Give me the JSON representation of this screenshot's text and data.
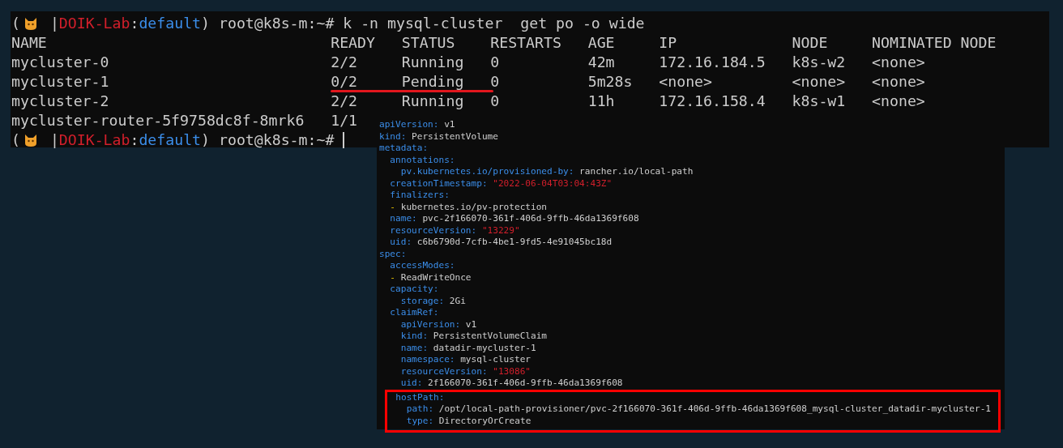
{
  "terminal": {
    "prompt": {
      "open": "(",
      "sep": " |",
      "context": "DOIK-Lab",
      "colon": ":",
      "namespace": "default",
      "rest": ") root@k8s-m:~#",
      "command": "k -n mysql-cluster  get po -o wide"
    },
    "columns": [
      "NAME",
      "READY",
      "STATUS",
      "RESTARTS",
      "AGE",
      "IP",
      "NODE",
      "NOMINATED NODE"
    ],
    "rows": [
      {
        "cells": [
          "mycluster-0",
          "2/2",
          "Running",
          "0",
          "42m",
          "172.16.184.5",
          "k8s-w2",
          "<none>"
        ],
        "underlined": false
      },
      {
        "cells": [
          "mycluster-1",
          "0/2",
          "Pending",
          "0",
          "5m28s",
          "<none>",
          "<none>",
          "<none>"
        ],
        "underlined": true
      },
      {
        "cells": [
          "mycluster-2",
          "2/2",
          "Running",
          "0",
          "11h",
          "172.16.158.4",
          "k8s-w1",
          "<none>"
        ],
        "underlined": false
      },
      {
        "cells": [
          "mycluster-router-5f9758dc8f-8mrk6",
          "1/1"
        ],
        "underlined": false
      }
    ],
    "prompt2": {
      "open": "(",
      "sep": " |",
      "context": "DOIK-Lab",
      "colon": ":",
      "namespace": "default",
      "rest": ") root@k8s-m:~#",
      "cursor": true
    }
  },
  "yaml": [
    {
      "key": "apiVersion:",
      "value": "v1",
      "kind": "plain"
    },
    {
      "key": "kind:",
      "value": "PersistentVolume",
      "kind": "plain"
    },
    {
      "key": "metadata:",
      "children": [
        {
          "key": "annotations:",
          "children": [
            {
              "key": "pv.kubernetes.io/provisioned-by:",
              "value": "rancher.io/local-path",
              "kind": "plain"
            }
          ]
        },
        {
          "key": "creationTimestamp:",
          "value": "\"2022-06-04T03:04:43Z\"",
          "kind": "string"
        },
        {
          "key": "finalizers:"
        },
        {
          "bullet": "-",
          "value": "kubernetes.io/pv-protection",
          "kind": "plain"
        },
        {
          "key": "name:",
          "value": "pvc-2f166070-361f-406d-9ffb-46da1369f608",
          "kind": "plain"
        },
        {
          "key": "resourceVersion:",
          "value": "\"13229\"",
          "kind": "string"
        },
        {
          "key": "uid:",
          "value": "c6b6790d-7cfb-4be1-9fd5-4e91045bc18d",
          "kind": "plain"
        }
      ]
    },
    {
      "key": "spec:",
      "children": [
        {
          "key": "accessModes:"
        },
        {
          "bullet": "-",
          "value": "ReadWriteOnce",
          "kind": "plain"
        },
        {
          "key": "capacity:",
          "children": [
            {
              "key": "storage:",
              "value": "2Gi",
              "kind": "plain"
            }
          ]
        },
        {
          "key": "claimRef:",
          "children": [
            {
              "key": "apiVersion:",
              "value": "v1",
              "kind": "plain"
            },
            {
              "key": "kind:",
              "value": "PersistentVolumeClaim",
              "kind": "plain"
            },
            {
              "key": "name:",
              "value": "datadir-mycluster-1",
              "kind": "plain"
            },
            {
              "key": "namespace:",
              "value": "mysql-cluster",
              "kind": "plain"
            },
            {
              "key": "resourceVersion:",
              "value": "\"13086\"",
              "kind": "string"
            },
            {
              "key": "uid:",
              "value": "2f166070-361f-406d-9ffb-46da1369f608",
              "kind": "plain"
            }
          ]
        },
        {
          "key": "hostPath:",
          "highlighted": true,
          "children": [
            {
              "key": "path:",
              "value": "/opt/local-path-provisioner/pvc-2f166070-361f-406d-9ffb-46da1369f608_mysql-cluster_datadir-mycluster-1",
              "kind": "plain"
            },
            {
              "key": "type:",
              "value": "DirectoryOrCreate",
              "kind": "plain"
            }
          ]
        }
      ]
    }
  ]
}
